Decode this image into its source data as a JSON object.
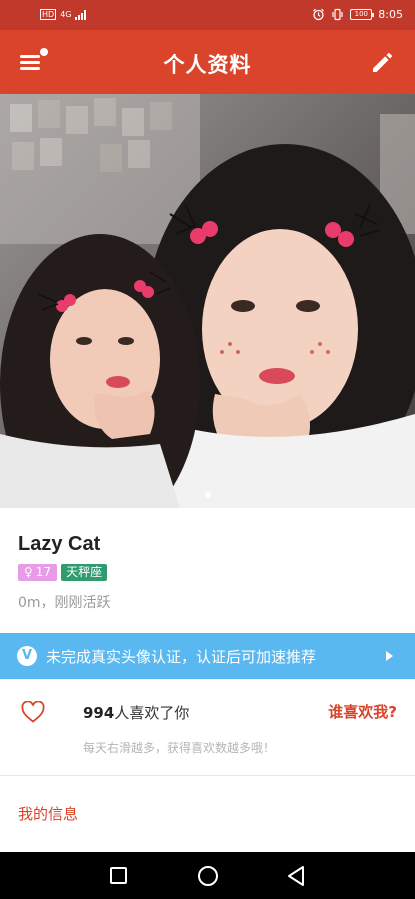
{
  "status_bar": {
    "network": "4G",
    "hd": "HD",
    "battery": "100",
    "time": "8:05"
  },
  "header": {
    "title": "个人资料"
  },
  "photo": {
    "page_count": 2,
    "active_page": 1
  },
  "profile": {
    "name": "Lazy Cat",
    "gender_symbol": "♀",
    "age": "17",
    "zodiac": "天秤座",
    "meta": "0m，刚刚活跃"
  },
  "verify_banner": {
    "icon_letter": "V",
    "text": "未完成真实头像认证，认证后可加速推荐"
  },
  "likes": {
    "count": "994",
    "suffix": "人喜欢了你",
    "who_likes": "谁喜欢我?",
    "tip": "每天右滑越多，获得喜欢数越多哦！"
  },
  "my_info": {
    "label": "我的信息"
  },
  "colors": {
    "status_bar": "#c0392b",
    "header": "#d9442b",
    "banner": "#5ab8f0",
    "gender_badge": "#e89be6",
    "zodiac_badge": "#2f9b6f"
  }
}
